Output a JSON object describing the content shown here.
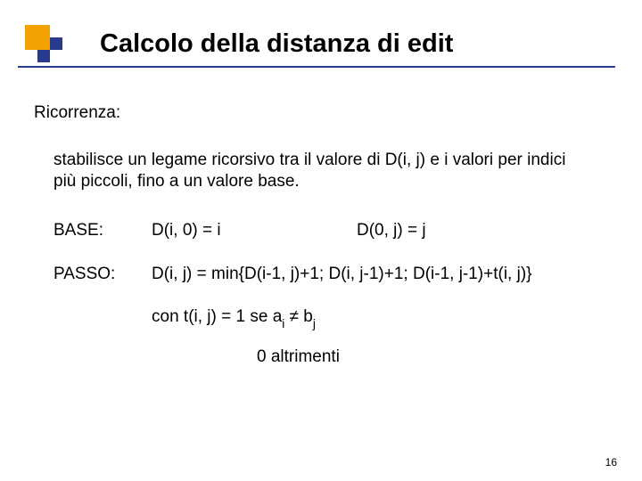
{
  "slide": {
    "title": "Calcolo della distanza di edit",
    "subheading": "Ricorrenza:",
    "paragraph": "stabilisce un legame ricorsivo tra il valore di D(i, j) e i valori per indici più piccoli, fino a un valore base.",
    "base": {
      "label": "BASE:",
      "expr1": "D(i, 0) = i",
      "expr2": "D(0, j) = j"
    },
    "passo": {
      "label": "PASSO:",
      "expr": "D(i, j) = min{D(i-1, j)+1; D(i, j-1)+1; D(i-1, j-1)+t(i, j)}"
    },
    "cond": {
      "prefix": "con t(i, j) = 1 se a",
      "sub1": "i",
      "mid": " ≠ b",
      "sub2": "j"
    },
    "else": "0 altrimenti",
    "page_number": "16"
  }
}
